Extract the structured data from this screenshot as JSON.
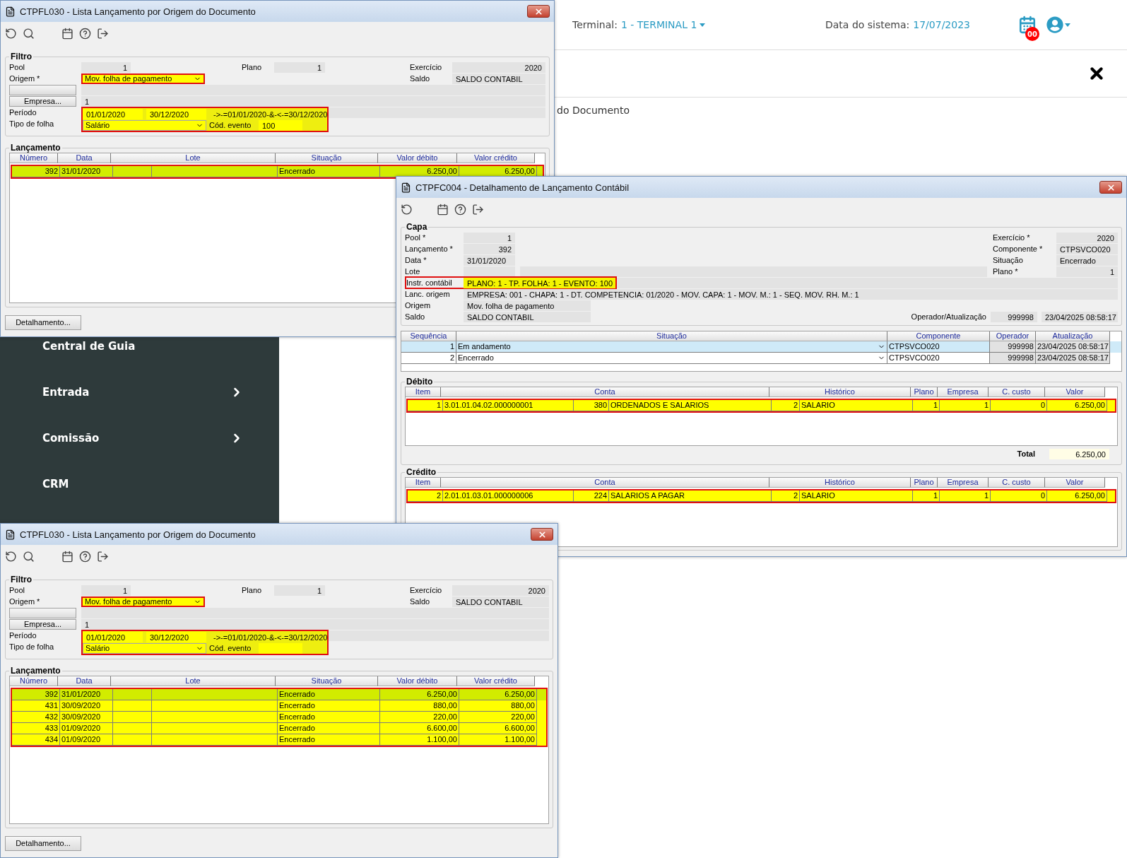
{
  "list_windows": [
    {
      "title": "CTPFL030 - Lista Lançamento por Origem do Documento",
      "filter": {
        "legend": "Filtro",
        "pool": {
          "label": "Pool",
          "value": "1"
        },
        "plano": {
          "label": "Plano",
          "value": "1"
        },
        "exercicio": {
          "label": "Exercício",
          "value": "2020"
        },
        "origem": {
          "label": "Origem *",
          "value": "Mov. folha de pagamento",
          "highlighted": true,
          "annotated": true
        },
        "saldo": {
          "label": "Saldo",
          "value": "SALDO CONTABIL"
        },
        "empresa": {
          "button": "Empresa...",
          "value": "1"
        },
        "periodo": {
          "label": "Período",
          "from": "01/01/2020",
          "to": "30/12/2020",
          "expression": "->-=01/01/2020-&-<-=30/12/2020",
          "highlighted": true,
          "annotated": true
        },
        "tipo_folha": {
          "label": "Tipo de folha",
          "value": "Salário"
        },
        "cod_evento": {
          "label": "Cód. evento",
          "value": "100"
        }
      },
      "table": {
        "legend": "Lançamento",
        "columns": [
          "Número",
          "Data",
          "Lote",
          "Situação",
          "Valor débito",
          "Valor crédito"
        ],
        "annotated": true,
        "rows": [
          {
            "numero": "392",
            "data": "31/01/2020",
            "situacao": "Encerrado",
            "valor_debito": "6.250,00",
            "valor_credito": "6.250,00",
            "highlighted": true,
            "selected": true
          }
        ]
      },
      "button": "Detalhamento..."
    },
    {
      "title": "CTPFL030 - Lista Lançamento por Origem do Documento",
      "filter": {
        "legend": "Filtro",
        "pool": {
          "label": "Pool",
          "value": "1"
        },
        "plano": {
          "label": "Plano",
          "value": "1"
        },
        "exercicio": {
          "label": "Exercício",
          "value": "2020"
        },
        "origem": {
          "label": "Origem *",
          "value": "Mov. folha de pagamento",
          "highlighted": true,
          "annotated": true
        },
        "saldo": {
          "label": "Saldo",
          "value": "SALDO CONTABIL"
        },
        "empresa": {
          "button": "Empresa...",
          "value": "1"
        },
        "periodo": {
          "label": "Período",
          "from": "01/01/2020",
          "to": "30/12/2020",
          "expression": "->-=01/01/2020-&-<-=30/12/2020",
          "highlighted": true,
          "annotated": true
        },
        "tipo_folha": {
          "label": "Tipo de folha",
          "value": "Salário"
        },
        "cod_evento": {
          "label": "Cód. evento"
        }
      },
      "table": {
        "legend": "Lançamento",
        "columns": [
          "Número",
          "Data",
          "Lote",
          "Situação",
          "Valor débito",
          "Valor crédito"
        ],
        "annotated": true,
        "rows": [
          {
            "numero": "392",
            "data": "31/01/2020",
            "situacao": "Encerrado",
            "valor_debito": "6.250,00",
            "valor_credito": "6.250,00",
            "highlighted": true,
            "selected": true
          },
          {
            "numero": "431",
            "data": "30/09/2020",
            "situacao": "Encerrado",
            "valor_debito": "880,00",
            "valor_credito": "880,00",
            "highlighted": true,
            "selected": false
          },
          {
            "numero": "432",
            "data": "30/09/2020",
            "situacao": "Encerrado",
            "valor_debito": "220,00",
            "valor_credito": "220,00",
            "highlighted": true,
            "selected": false
          },
          {
            "numero": "433",
            "data": "01/09/2020",
            "situacao": "Encerrado",
            "valor_debito": "6.600,00",
            "valor_credito": "6.600,00",
            "highlighted": true,
            "selected": false
          },
          {
            "numero": "434",
            "data": "01/09/2020",
            "situacao": "Encerrado",
            "valor_debito": "1.100,00",
            "valor_credito": "1.100,00",
            "highlighted": true,
            "selected": false
          }
        ]
      },
      "button": "Detalhamento..."
    }
  ],
  "web_page": {
    "terminal_label": "Terminal:",
    "terminal": "1 - TERMINAL 1",
    "date_label": "Data do sistema:",
    "date": "17/07/2023",
    "notification_count": "00",
    "heading": "do Documento",
    "sidebar": [
      {
        "label": "Central de Guia",
        "submenu": false
      },
      {
        "label": "Entrada",
        "submenu": true
      },
      {
        "label": "Comissão",
        "submenu": true
      },
      {
        "label": "CRM",
        "submenu": false
      }
    ]
  },
  "detail_window": {
    "title": "CTPFC004 - Detalhamento de Lançamento Contábil",
    "capa": {
      "legend": "Capa",
      "pool": {
        "label": "Pool *",
        "value": "1"
      },
      "lancamento": {
        "label": "Lançamento *",
        "value": "392"
      },
      "data": {
        "label": "Data *",
        "value": "31/01/2020"
      },
      "lote": {
        "label": "Lote"
      },
      "exercicio": {
        "label": "Exercício *",
        "value": "2020"
      },
      "componente": {
        "label": "Componente *",
        "value": "CTPSVCO020"
      },
      "situacao": {
        "label": "Situação",
        "value": "Encerrado"
      },
      "plano": {
        "label": "Plano *",
        "value": "1"
      },
      "instr_contabil": {
        "label": "Instr. contábil",
        "value": "PLANO: 1 - TP. FOLHA: 1 - EVENTO: 100",
        "highlighted": true,
        "annotated": true
      },
      "lanc_origem": {
        "label": "Lanc. origem",
        "value": "EMPRESA: 001 - CHAPA: 1 - DT. COMPETENCIA: 01/2020 - MOV. CAPA: 1 - MOV. M.: 1 - SEQ. MOV. RH. M.: 1"
      },
      "origem": {
        "label": "Origem",
        "value": "Mov. folha de pagamento"
      },
      "saldo": {
        "label": "Saldo",
        "value": "SALDO CONTABIL"
      },
      "operador": {
        "label": "Operador/Atualização",
        "value": "999998",
        "date": "23/04/2025 08:58:17"
      }
    },
    "history": {
      "columns": [
        "Sequência",
        "Situação",
        "Componente",
        "Operador",
        "Atualização"
      ],
      "rows": [
        {
          "sequencia": "1",
          "situacao": "Em andamento",
          "componente": "CTPSVCO020",
          "operador": "999998",
          "atualizacao": "23/04/2025 08:58:17",
          "selected": true
        },
        {
          "sequencia": "2",
          "situacao": "Encerrado",
          "componente": "CTPSVCO020",
          "operador": "999998",
          "atualizacao": "23/04/2025 08:58:17",
          "selected": false
        }
      ]
    },
    "debito": {
      "legend": "Débito",
      "columns": [
        "Item",
        "Conta",
        "Histórico",
        "Plano",
        "Empresa",
        "C. custo",
        "Valor"
      ],
      "annotated": true,
      "rows": [
        {
          "item": "1",
          "conta": "3.01.01.04.02.000000001",
          "conta_codigo": "380",
          "conta_nome": "ORDENADOS E SALARIOS",
          "historico_codigo": "2",
          "historico": "SALARIO",
          "plano": "1",
          "empresa": "1",
          "c_custo": "0",
          "valor": "6.250,00",
          "highlighted": true
        }
      ],
      "total_label": "Total",
      "total": "6.250,00"
    },
    "credito": {
      "legend": "Crédito",
      "columns": [
        "Item",
        "Conta",
        "Histórico",
        "Plano",
        "Empresa",
        "C. custo",
        "Valor"
      ],
      "annotated": true,
      "rows": [
        {
          "item": "2",
          "conta": "2.01.01.03.01.000000006",
          "conta_codigo": "224",
          "conta_nome": "SALARIOS A PAGAR",
          "historico_codigo": "2",
          "historico": "SALARIO",
          "plano": "1",
          "empresa": "1",
          "c_custo": "0",
          "valor": "6.250,00",
          "highlighted": true
        }
      ]
    }
  }
}
